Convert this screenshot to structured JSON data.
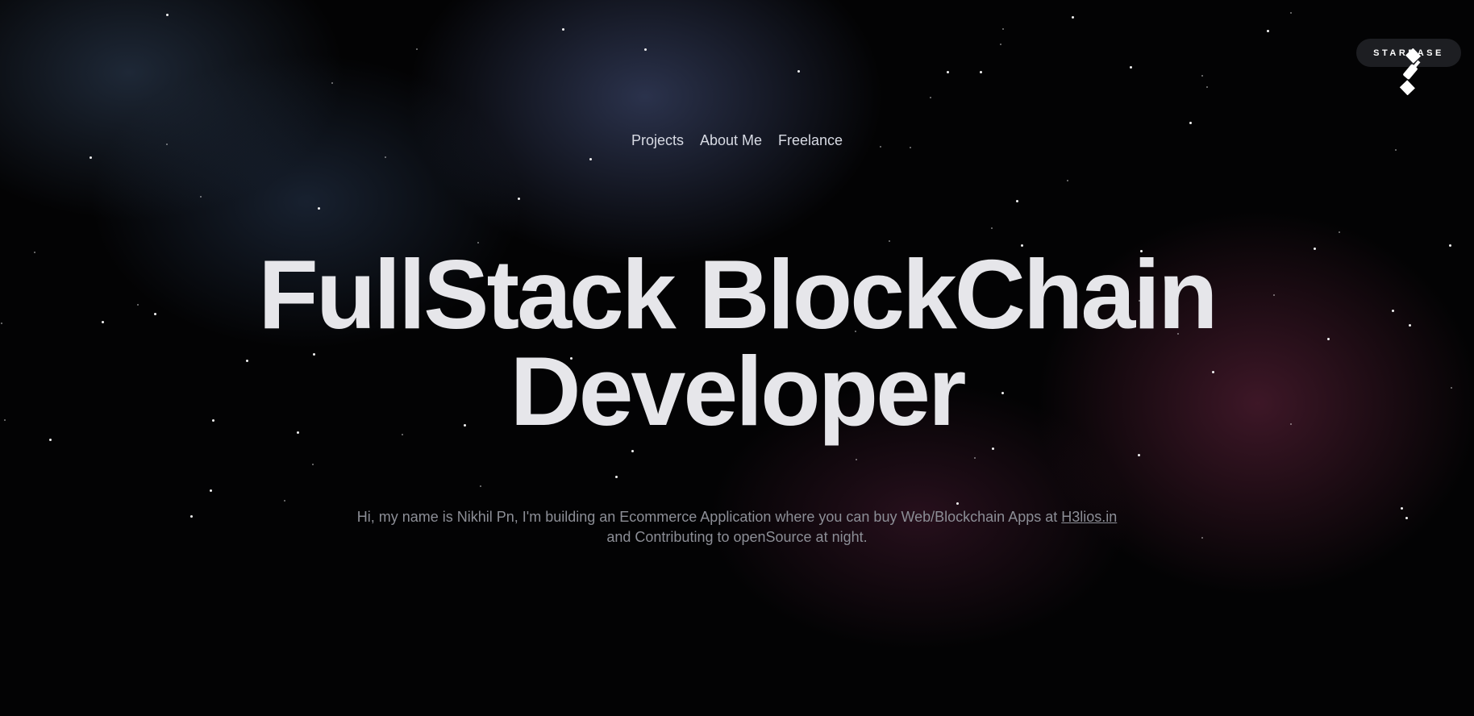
{
  "nav": {
    "items": [
      "Projects",
      "About Me",
      "Freelance"
    ]
  },
  "badge": {
    "label": "STARBASE",
    "icon": "satellite-icon"
  },
  "hero": {
    "line1": "FullStack BlockChain",
    "line2": "Developer"
  },
  "intro": {
    "text_before_link": "Hi, my name is Nikhil Pn, I'm building an Ecommerce Application where you can buy Web/Blockchain Apps at ",
    "link_text": "H3lios.in",
    "text_after_link": "and Contributing to openSource at night."
  },
  "colors": {
    "background": "#030304",
    "heading": "#e6e6ea",
    "nav_text": "#d8dbe4",
    "body_text": "#8c8e96",
    "glow_blue": "#384464",
    "glow_pink": "#64243e"
  }
}
